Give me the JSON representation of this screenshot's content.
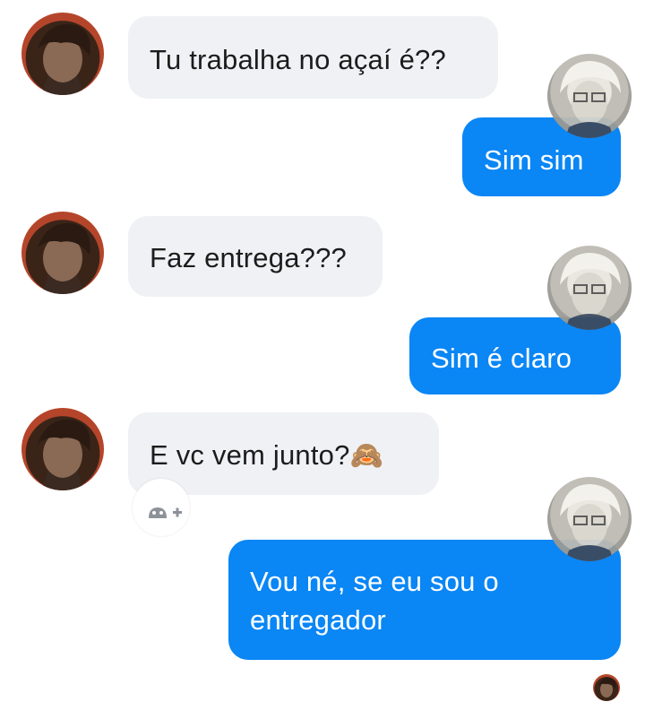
{
  "messages": [
    {
      "side": "received",
      "text": "Tu trabalha no açaí é??",
      "avatar": "avatar-dark-haired-character"
    },
    {
      "side": "sent",
      "text": "Sim sim",
      "avatar": "avatar-white-haired-character"
    },
    {
      "side": "received",
      "text": "Faz entrega???",
      "avatar": "avatar-dark-haired-character"
    },
    {
      "side": "sent",
      "text": "Sim é  claro",
      "avatar": "avatar-white-haired-character"
    },
    {
      "side": "received",
      "text": "E vc vem junto?",
      "emoji": "🙈",
      "avatar": "avatar-dark-haired-character"
    },
    {
      "side": "sent",
      "text_line1": "Vou né, se eu sou o",
      "text_line2": "entregador",
      "avatar": "avatar-white-haired-character"
    }
  ],
  "reaction_button_icon": "add-reaction-icon",
  "seen_indicator": "seen-avatar",
  "colors": {
    "received_bubble": "#f0f1f4",
    "sent_bubble": "#0a86f5",
    "received_text": "#1c1c1c",
    "sent_text": "#ffffff"
  }
}
